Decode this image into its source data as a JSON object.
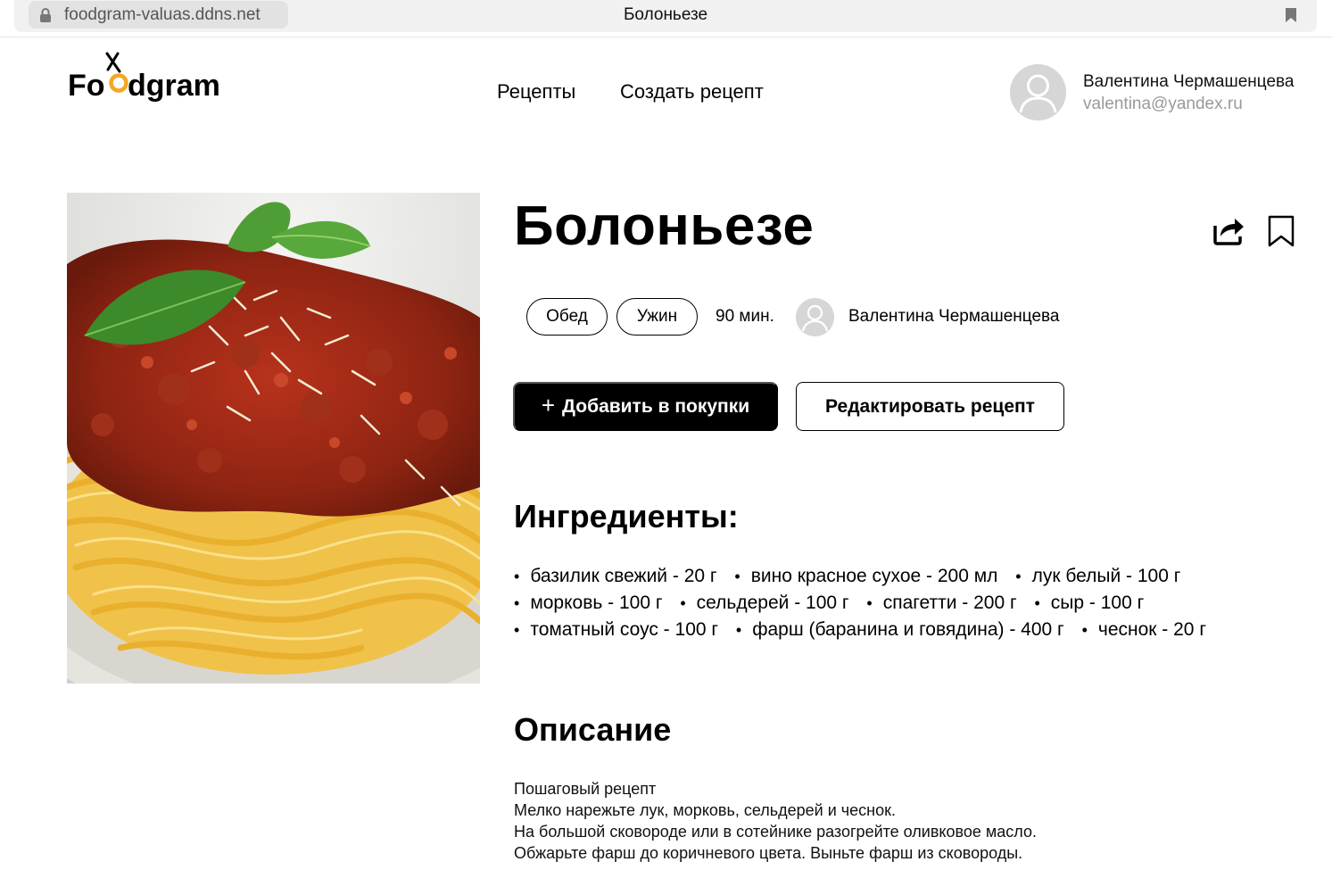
{
  "browser": {
    "url": "foodgram-valuas.ddns.net",
    "tab_title": "Болоньезе"
  },
  "header": {
    "logo_text": "Foodgram",
    "nav": {
      "recipes": "Рецепты",
      "create_recipe": "Создать рецепт"
    },
    "user": {
      "name": "Валентина Чермашенцева",
      "email": "valentina@yandex.ru"
    }
  },
  "recipe": {
    "title": "Болоньезе",
    "tags": [
      "Обед",
      "Ужин"
    ],
    "cooking_time": "90 мин.",
    "author": "Валентина Чермашенцева",
    "actions": {
      "add_to_shopping": "Добавить в покупки",
      "add_to_shopping_icon": "+",
      "edit": "Редактировать рецепт"
    },
    "ingredients_heading": "Ингредиенты:",
    "ingredients_lines": [
      [
        "базилик свежий - 20 г",
        "вино красное сухое - 200 мл",
        "лук белый - 100 г"
      ],
      [
        "морковь - 100 г",
        "сельдерей - 100 г",
        "спагетти - 200 г",
        "сыр - 100 г"
      ],
      [
        "томатный соус - 100 г",
        "фарш (баранина и говядина) - 400 г",
        "чеснок - 20 г"
      ]
    ],
    "description_heading": "Описание",
    "description_lines": [
      "Пошаговый рецепт",
      "Мелко нарежьте лук, морковь, сельдерей и чеснок.",
      "На большой сковороде или в сотейнике разогрейте оливковое масло.",
      "Обжарьте фарш до коричневого цвета. Выньте фарш из сковороды."
    ]
  },
  "colors": {
    "accent": "#000000",
    "logo_orange": "#f5a623",
    "muted": "#9a9a9a"
  }
}
